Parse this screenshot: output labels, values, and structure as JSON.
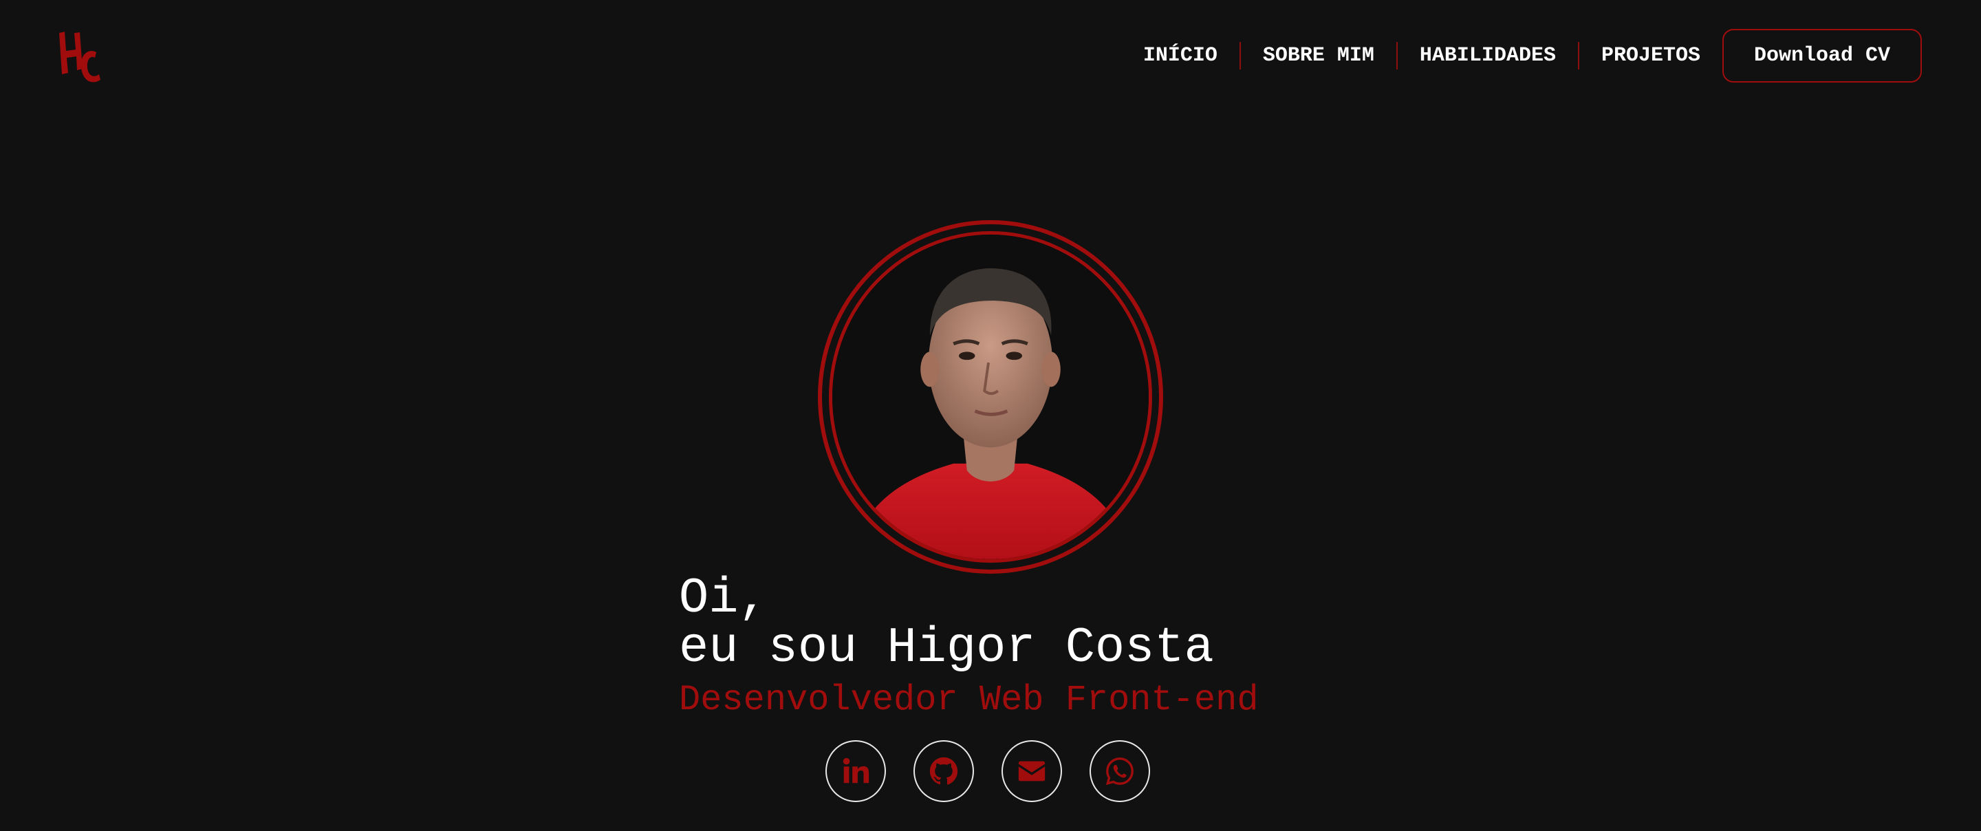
{
  "header": {
    "logo_icon": "hc-monogram-logo",
    "nav": [
      {
        "label": "INÍCIO"
      },
      {
        "label": "SOBRE MIM"
      },
      {
        "label": "HABILIDADES"
      },
      {
        "label": "PROJETOS"
      }
    ],
    "cv_button_label": "Download CV"
  },
  "hero": {
    "greeting_line1": "Oi,",
    "greeting_line2": "eu sou Higor Costa",
    "role": "Desenvolvedor Web Front-end",
    "avatar_icon": "profile-photo"
  },
  "socials": [
    {
      "icon": "linkedin-icon"
    },
    {
      "icon": "github-icon"
    },
    {
      "icon": "envelope-icon"
    },
    {
      "icon": "whatsapp-icon"
    }
  ],
  "colors": {
    "background": "#111111",
    "accent": "#a10d0d",
    "text": "#ffffff"
  }
}
